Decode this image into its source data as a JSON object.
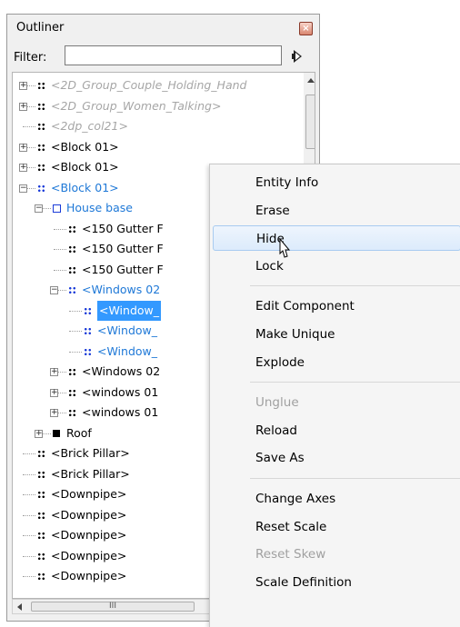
{
  "outliner": {
    "title": "Outliner",
    "close_icon": "close-icon",
    "filter_label": "Filter:",
    "filter_value": "",
    "filter_go_icon": "filter-apply-arrow-icon",
    "hscroll_grip": "III",
    "rows": [
      {
        "label": "<2D_Group_Couple_Holding_Hand",
        "style": "grey",
        "expander": "+",
        "icon": "component"
      },
      {
        "label": "<2D_Group_Women_Talking>",
        "style": "grey",
        "expander": "+",
        "icon": "component"
      },
      {
        "label": "<2dp_col21>",
        "style": "grey",
        "expander": "",
        "icon": "component"
      },
      {
        "label": "<Block 01>",
        "style": "normal",
        "expander": "+",
        "icon": "component"
      },
      {
        "label": "<Block 01>",
        "style": "normal",
        "expander": "+",
        "icon": "component"
      },
      {
        "label": "<Block 01>",
        "style": "blue",
        "expander": "-",
        "icon": "component-blue"
      },
      {
        "label": "House base",
        "style": "blue",
        "expander": "-",
        "icon": "group"
      },
      {
        "label": "<150 Gutter F",
        "style": "normal",
        "expander": "",
        "icon": "component"
      },
      {
        "label": "<150 Gutter F",
        "style": "normal",
        "expander": "",
        "icon": "component"
      },
      {
        "label": "<150 Gutter F",
        "style": "normal",
        "expander": "",
        "icon": "component"
      },
      {
        "label": "<Windows 02",
        "style": "blue",
        "expander": "-",
        "icon": "component-blue"
      },
      {
        "label": "<Window_",
        "style": "selected",
        "expander": "",
        "icon": "component-blue"
      },
      {
        "label": "<Window_",
        "style": "blue",
        "expander": "",
        "icon": "component-blue"
      },
      {
        "label": "<Window_",
        "style": "blue",
        "expander": "",
        "icon": "component-blue"
      },
      {
        "label": "<Windows 02",
        "style": "normal",
        "expander": "+",
        "icon": "component"
      },
      {
        "label": "<windows 01",
        "style": "normal",
        "expander": "+",
        "icon": "component"
      },
      {
        "label": "<windows 01",
        "style": "normal",
        "expander": "+",
        "icon": "component"
      },
      {
        "label": "Roof",
        "style": "normal",
        "expander": "+",
        "icon": "solid"
      },
      {
        "label": "<Brick Pillar>",
        "style": "normal",
        "expander": "",
        "icon": "component"
      },
      {
        "label": "<Brick Pillar>",
        "style": "normal",
        "expander": "",
        "icon": "component"
      },
      {
        "label": "<Downpipe>",
        "style": "normal",
        "expander": "",
        "icon": "component"
      },
      {
        "label": "<Downpipe>",
        "style": "normal",
        "expander": "",
        "icon": "component"
      },
      {
        "label": "<Downpipe>",
        "style": "normal",
        "expander": "",
        "icon": "component"
      },
      {
        "label": "<Downpipe>",
        "style": "normal",
        "expander": "",
        "icon": "component"
      },
      {
        "label": "<Downpipe>",
        "style": "normal",
        "expander": "",
        "icon": "component"
      }
    ]
  },
  "context_menu": {
    "items": [
      {
        "label": "Entity Info",
        "enabled": true
      },
      {
        "label": "Erase",
        "enabled": true
      },
      {
        "label": "Hide",
        "enabled": true,
        "hover": true
      },
      {
        "label": "Lock",
        "enabled": true
      },
      {
        "separator": true
      },
      {
        "label": "Edit Component",
        "enabled": true
      },
      {
        "label": "Make Unique",
        "enabled": true
      },
      {
        "label": "Explode",
        "enabled": true
      },
      {
        "separator": true
      },
      {
        "label": "Unglue",
        "enabled": false
      },
      {
        "label": "Reload",
        "enabled": true
      },
      {
        "label": "Save As",
        "enabled": true
      },
      {
        "separator": true
      },
      {
        "label": "Change Axes",
        "enabled": true
      },
      {
        "label": "Reset Scale",
        "enabled": true
      },
      {
        "label": "Reset Skew",
        "enabled": false
      },
      {
        "label": "Scale Definition",
        "enabled": true
      }
    ],
    "cursor_icon": "mouse-pointer-icon"
  },
  "colors": {
    "selection": "#3399ff",
    "active_text": "#1e78d7",
    "hidden_text": "#a6a6a6",
    "menu_hover": "#dcebfc"
  }
}
